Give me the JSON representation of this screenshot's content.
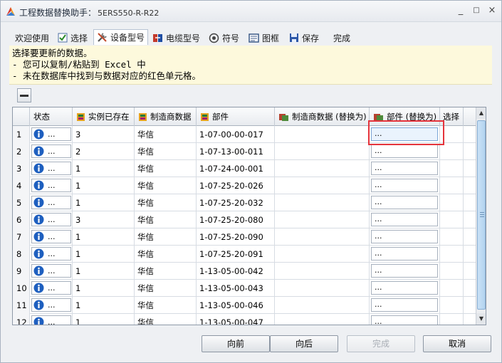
{
  "window": {
    "title": "工程数据替换助手：",
    "subtitle": "5ERS550-R-R22",
    "controls": [
      "_",
      "□",
      "×"
    ]
  },
  "toolbar": {
    "items": [
      {
        "label": "欢迎使用",
        "icon": "",
        "active": false
      },
      {
        "label": "选择",
        "icon": "checkbox-icon",
        "active": false
      },
      {
        "label": "设备型号",
        "icon": "tools-icon",
        "active": true
      },
      {
        "label": "电缆型号",
        "icon": "cable-icon",
        "active": false
      },
      {
        "label": "符号",
        "icon": "symbol-icon",
        "active": false
      },
      {
        "label": "图框",
        "icon": "frame-icon",
        "active": false
      },
      {
        "label": "保存",
        "icon": "save-icon",
        "active": false
      },
      {
        "label": "完成",
        "icon": "",
        "active": false
      }
    ]
  },
  "info": {
    "line1": "选择要更新的数据。",
    "line2": "- 您可以复制/粘贴到 Excel 中",
    "line3": "- 未在数据库中找到与数据对应的红色单元格。"
  },
  "grid": {
    "columns": {
      "status": "状态",
      "instances": "实例已存在",
      "manufacturer": "制造商数据",
      "part": "部件",
      "manufacturer_replace": "制造商数据 (替换为)",
      "part_replace": "部件 (替换为)",
      "select": "选择"
    },
    "rows": [
      {
        "num": "1",
        "status": "...",
        "instances": "3",
        "manufacturer": "华信",
        "part": "1-07-00-00-017",
        "part_replace": "..."
      },
      {
        "num": "2",
        "status": "...",
        "instances": "2",
        "manufacturer": "华信",
        "part": "1-07-13-00-011",
        "part_replace": "..."
      },
      {
        "num": "3",
        "status": "...",
        "instances": "1",
        "manufacturer": "华信",
        "part": "1-07-24-00-001",
        "part_replace": "..."
      },
      {
        "num": "4",
        "status": "...",
        "instances": "1",
        "manufacturer": "华信",
        "part": "1-07-25-20-026",
        "part_replace": "..."
      },
      {
        "num": "5",
        "status": "...",
        "instances": "1",
        "manufacturer": "华信",
        "part": "1-07-25-20-032",
        "part_replace": "..."
      },
      {
        "num": "6",
        "status": "...",
        "instances": "3",
        "manufacturer": "华信",
        "part": "1-07-25-20-080",
        "part_replace": "..."
      },
      {
        "num": "7",
        "status": "...",
        "instances": "1",
        "manufacturer": "华信",
        "part": "1-07-25-20-090",
        "part_replace": "..."
      },
      {
        "num": "8",
        "status": "...",
        "instances": "1",
        "manufacturer": "华信",
        "part": "1-07-25-20-091",
        "part_replace": "..."
      },
      {
        "num": "9",
        "status": "...",
        "instances": "1",
        "manufacturer": "华信",
        "part": "1-13-05-00-042",
        "part_replace": "..."
      },
      {
        "num": "10",
        "status": "...",
        "instances": "1",
        "manufacturer": "华信",
        "part": "1-13-05-00-043",
        "part_replace": "..."
      },
      {
        "num": "11",
        "status": "...",
        "instances": "1",
        "manufacturer": "华信",
        "part": "1-13-05-00-046",
        "part_replace": "..."
      },
      {
        "num": "12",
        "status": "...",
        "instances": "1",
        "manufacturer": "华信",
        "part": "1-13-05-00-047",
        "part_replace": "..."
      }
    ]
  },
  "buttons": {
    "back": "向前",
    "next": "向后",
    "finish": "完成",
    "cancel": "取消"
  },
  "colors": {
    "info_bg": "#fdf9dc",
    "highlight": "#e5333b",
    "status_icon": "#1e5fbf"
  }
}
